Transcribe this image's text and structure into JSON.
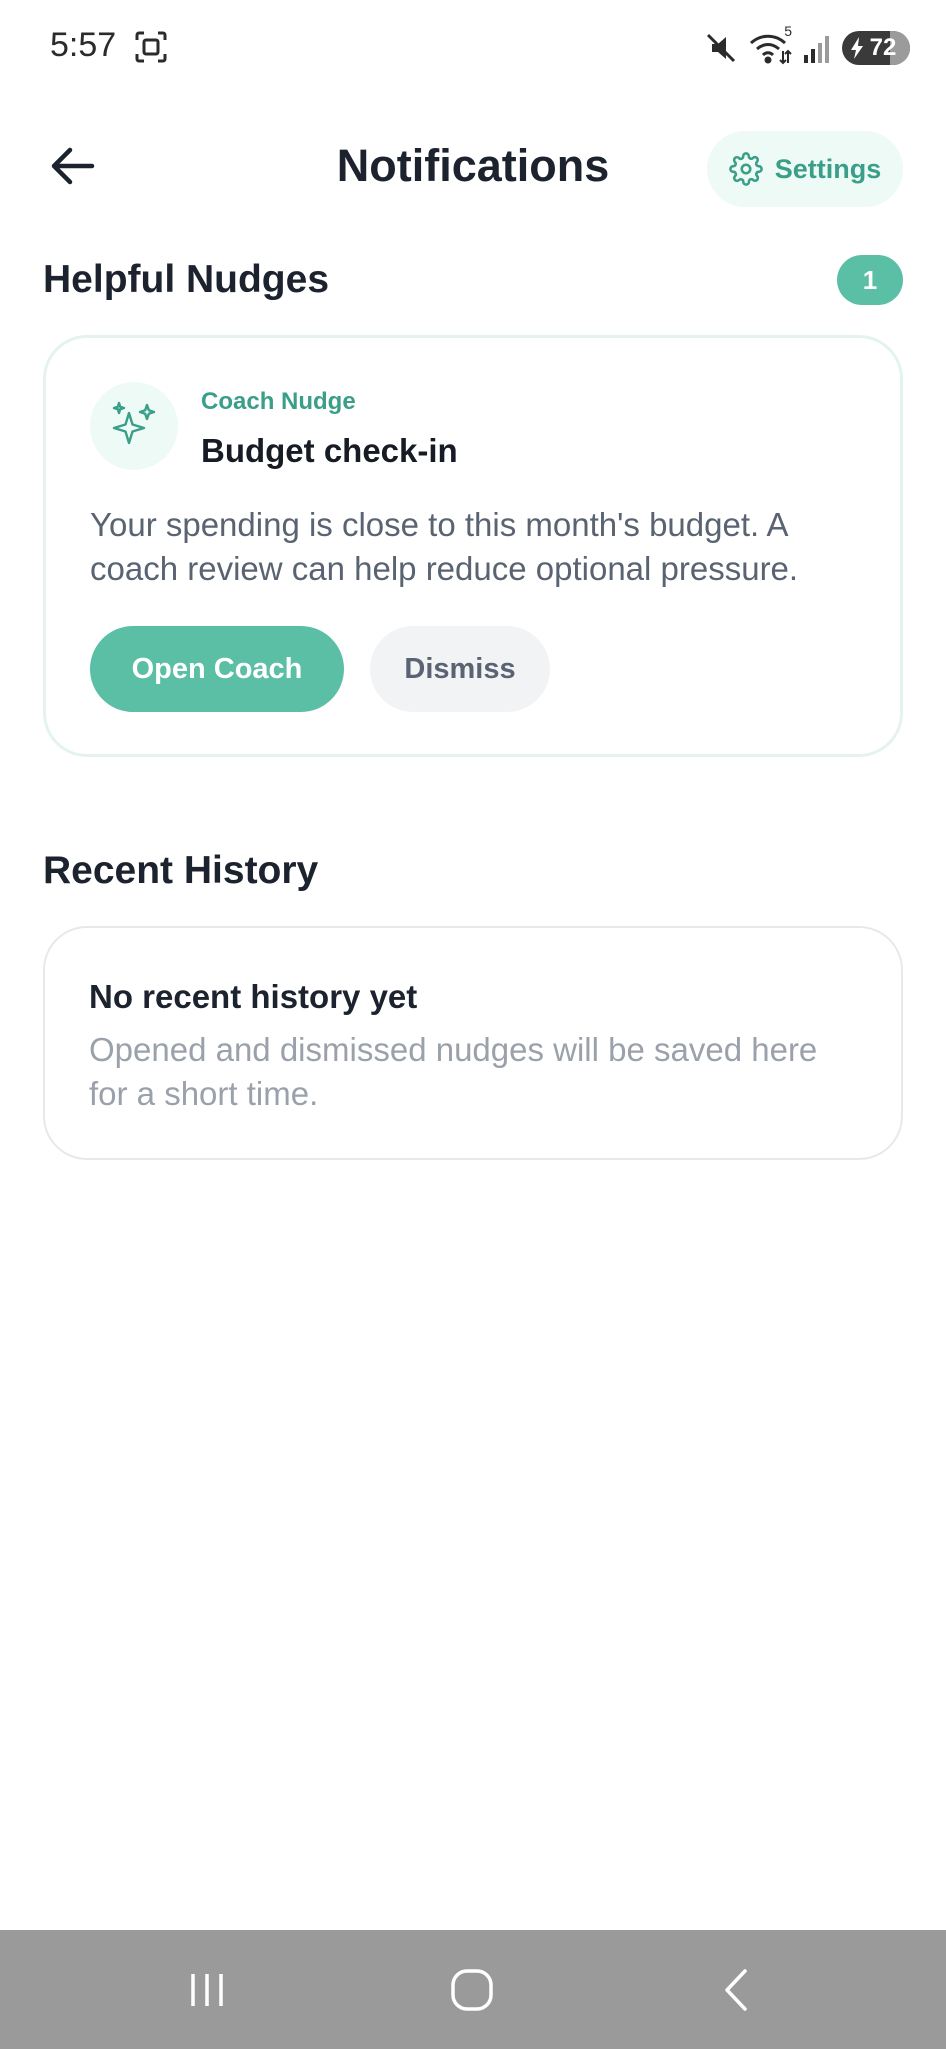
{
  "status_bar": {
    "time": "5:57",
    "battery": "72",
    "network_tag": "5"
  },
  "header": {
    "title": "Notifications",
    "settings_label": "Settings"
  },
  "nudges": {
    "section_title": "Helpful Nudges",
    "count": "1",
    "card": {
      "label": "Coach Nudge",
      "title": "Budget check-in",
      "message": "Your spending is close to this month's budget. A coach review can help reduce optional pressure.",
      "primary_label": "Open Coach",
      "secondary_label": "Dismiss"
    }
  },
  "history": {
    "section_title": "Recent History",
    "empty_title": "No recent history yet",
    "empty_message": "Opened and dismissed nudges will be saved here for a short time."
  },
  "colors": {
    "accent": "#5bbfa6",
    "accent_text": "#3a9e88",
    "accent_soft": "#eefaf5",
    "text_primary": "#1c232e",
    "text_secondary": "#5a6371",
    "text_muted": "#9aa1ab"
  },
  "icons": {
    "back": "arrow-left-icon",
    "settings": "gear-icon",
    "nudge": "sparkles-icon"
  }
}
